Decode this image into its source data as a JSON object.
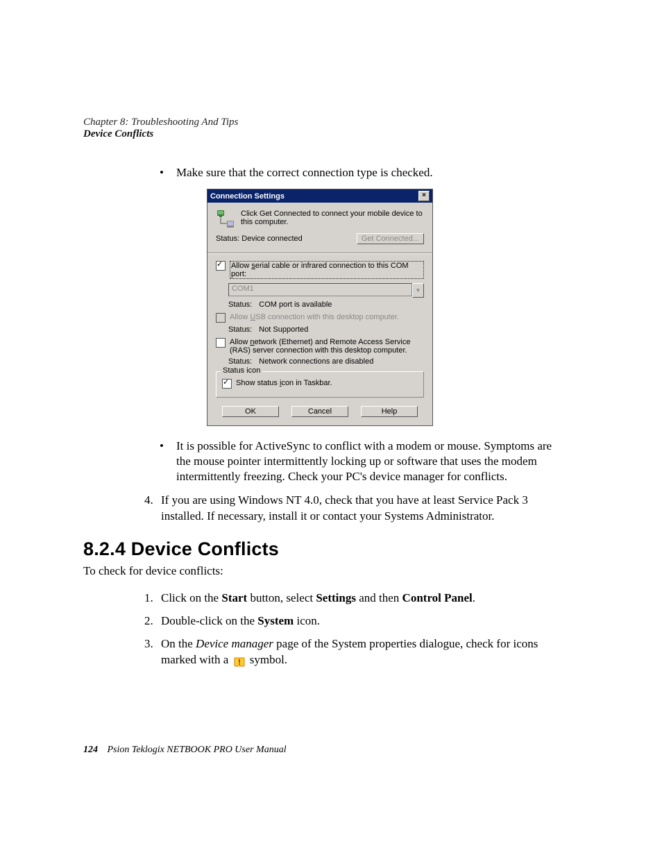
{
  "header": {
    "chapter": "Chapter 8:  Troubleshooting And Tips",
    "subtitle": "Device Conflicts"
  },
  "bullet1": "Make sure that the correct connection type is checked.",
  "dialog": {
    "title": "Connection Settings",
    "instruction": "Click Get Connected to connect your mobile device to this computer.",
    "status_label": "Status: Device connected",
    "get_connected": "Get Connected...",
    "serial_prefix": "Allow ",
    "serial_s": "s",
    "serial_rest": "erial cable or infrared connection to this COM port:",
    "combo_value": "COM1",
    "serial_status_label": "Status:",
    "serial_status_value": "COM port is available",
    "usb_prefix": "Allow ",
    "usb_u": "U",
    "usb_rest": "SB connection with this desktop computer.",
    "usb_status_label": "Status:",
    "usb_status_value": "Not Supported",
    "net_prefix": "Allow ",
    "net_n": "n",
    "net_rest": "etwork (Ethernet) and Remote Access Service (RAS) server connection with this desktop computer.",
    "net_status_label": "Status:",
    "net_status_value": "Network connections are disabled",
    "legend": "Status icon",
    "show_prefix": "Show status ",
    "show_i": "i",
    "show_rest": "con in Taskbar.",
    "ok": "OK",
    "cancel": "Cancel",
    "help": "Help"
  },
  "bullet2": "It is possible for ActiveSync to conflict with a modem or mouse. Symptoms are the mouse pointer intermittently locking up or software that uses the modem intermittently freezing. Check your PC's device manager for conflicts.",
  "step4": "If you are using Windows NT 4.0, check that you have at least Service Pack 3 installed. If necessary, install it or contact your Systems Administrator.",
  "section_heading": "8.2.4  Device Conflicts",
  "intro": "To check for device conflicts:",
  "ol1_a": "Click on the ",
  "ol1_b": "Start",
  "ol1_c": " button, select ",
  "ol1_d": "Settings",
  "ol1_e": " and then ",
  "ol1_f": "Control Panel",
  "ol1_g": ".",
  "ol2_a": "Double-click on the ",
  "ol2_b": "System",
  "ol2_c": " icon.",
  "ol3_a": "On the ",
  "ol3_b": "Device manager",
  "ol3_c": " page of the System properties dialogue, check for icons marked with a ",
  "ol3_d": " symbol.",
  "footer": {
    "page": "124",
    "text": "Psion Teklogix NETBOOK PRO User Manual"
  }
}
